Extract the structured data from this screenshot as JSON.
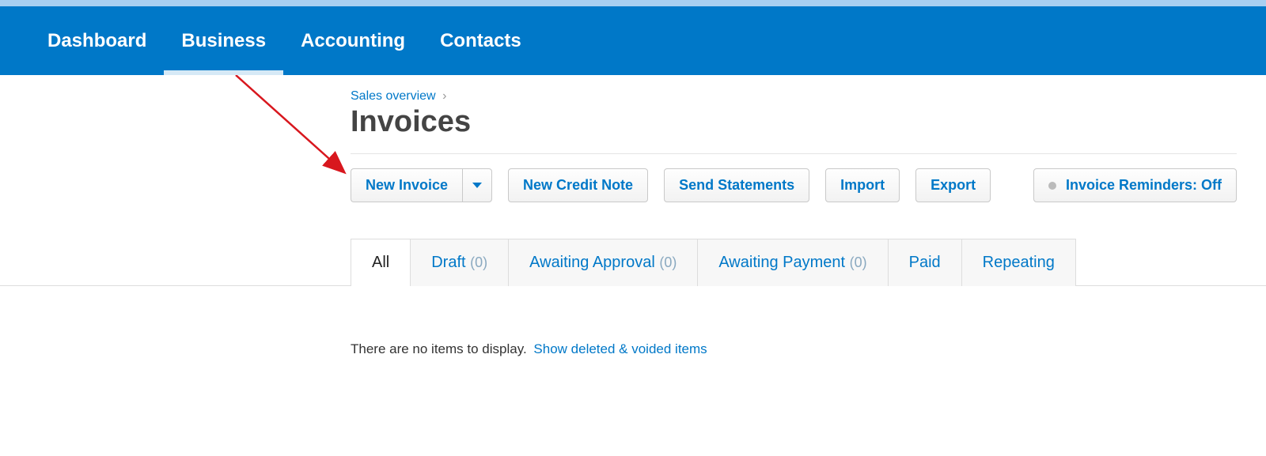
{
  "nav": {
    "items": [
      {
        "label": "Dashboard"
      },
      {
        "label": "Business",
        "active": true
      },
      {
        "label": "Accounting"
      },
      {
        "label": "Contacts"
      }
    ]
  },
  "breadcrumb": {
    "link_text": "Sales overview",
    "separator": "›"
  },
  "page_title": "Invoices",
  "toolbar": {
    "new_invoice": "New Invoice",
    "new_credit_note": "New Credit Note",
    "send_statements": "Send Statements",
    "import": "Import",
    "export": "Export",
    "reminders": "Invoice Reminders: Off"
  },
  "tabs": [
    {
      "label": "All",
      "count": "",
      "active": true
    },
    {
      "label": "Draft",
      "count": "(0)"
    },
    {
      "label": "Awaiting Approval",
      "count": "(0)"
    },
    {
      "label": "Awaiting Payment",
      "count": "(0)"
    },
    {
      "label": "Paid",
      "count": ""
    },
    {
      "label": "Repeating",
      "count": ""
    }
  ],
  "empty": {
    "text": "There are no items to display.",
    "link": "Show deleted & voided items"
  }
}
